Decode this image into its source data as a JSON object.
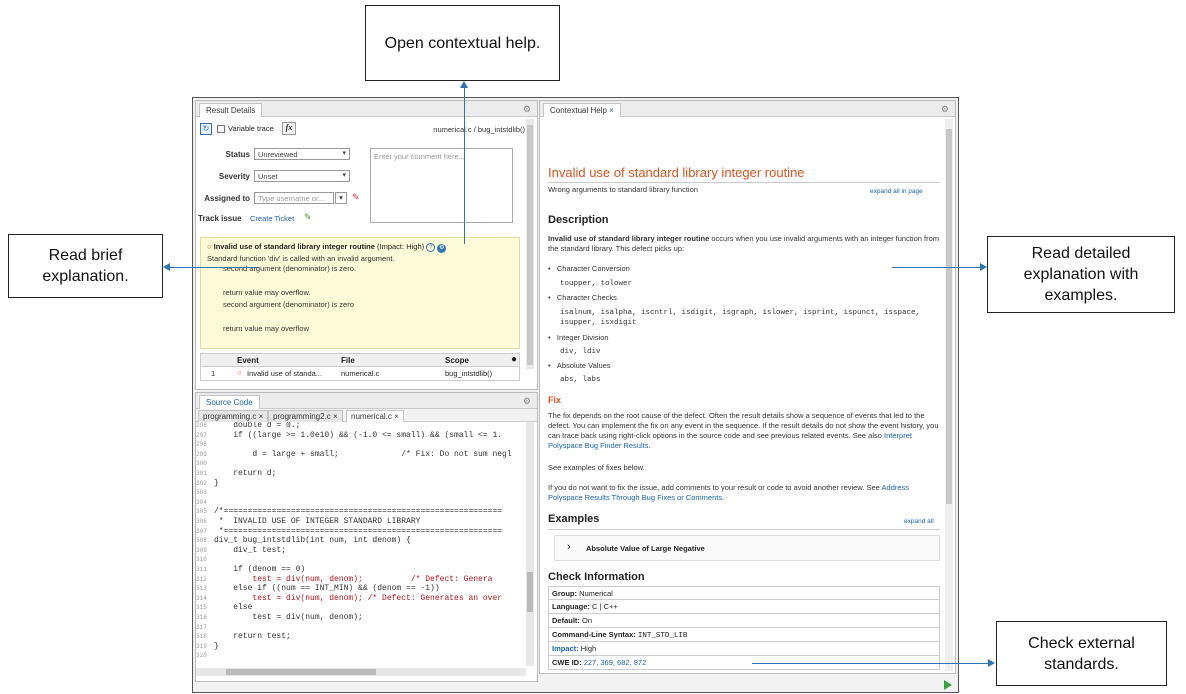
{
  "callouts": {
    "open_help": "Open contextual help.",
    "brief": "Read brief explanation.",
    "detailed": "Read detailed explanation with examples.",
    "standards": "Check external standards."
  },
  "result_details": {
    "tab": "Result Details",
    "variable_trace": "Variable trace",
    "fx": "fx",
    "file_func": "numerical.c / bug_intstdlib()",
    "status_label": "Status",
    "status_value": "Unreviewed",
    "severity_label": "Severity",
    "severity_value": "Unset",
    "assigned_label": "Assigned to",
    "assigned_placeholder": "Type username or...",
    "track_label": "Track issue",
    "create_ticket": "Create Ticket",
    "comment_placeholder": "Enter your comment here...",
    "defect_title": "Invalid use of standard library integer routine",
    "defect_impact": "(Impact: High)",
    "defect_lines": [
      "Standard function 'div' is called with an invalid argument.",
      "second argument (denominator) is zero.",
      "",
      "return value may overflow.",
      "second argument (denominator) is zero",
      "",
      "return value may overflow"
    ],
    "events_headers": [
      "Event",
      "File",
      "Scope"
    ],
    "events_row": {
      "num": "1",
      "event": "Invalid use of standa...",
      "file": "numerical.c",
      "scope": "bug_intstdlib()"
    }
  },
  "source": {
    "tab": "Source Code",
    "file_tabs": [
      "programming.c",
      "programming2.c",
      "numerical.c"
    ],
    "lines": [
      [
        "296",
        "    double d = 0.;"
      ],
      [
        "297",
        "    if ((large >= 1.0e10) && (-1.0 <= small) && (small <= 1."
      ],
      [
        "298",
        ""
      ],
      [
        "299",
        "        d = large + small;             /* Fix: Do not sum negl"
      ],
      [
        "300",
        ""
      ],
      [
        "301",
        "    return d;"
      ],
      [
        "302",
        "}"
      ],
      [
        "303",
        ""
      ],
      [
        "304",
        ""
      ],
      [
        "305",
        "/*=========================================================="
      ],
      [
        "306",
        " *  INVALID USE OF INTEGER STANDARD LIBRARY"
      ],
      [
        "307",
        " *=========================================================="
      ],
      [
        "308",
        "div_t bug_intstdlib(int num, int denom) {"
      ],
      [
        "309",
        "    div_t test;"
      ],
      [
        "310",
        ""
      ],
      [
        "311",
        "    if (denom == 0)"
      ],
      [
        "312",
        "        test = div(num, denom);          /* Defect: Genera"
      ],
      [
        "313",
        "    else if ((num == INT_MIN) && (denom == -1))"
      ],
      [
        "314",
        "        test = div(num, denom); /* Defect: Generates an over"
      ],
      [
        "315",
        "    else"
      ],
      [
        "316",
        "        test = div(num, denom);"
      ],
      [
        "317",
        ""
      ],
      [
        "318",
        "    return test;"
      ],
      [
        "319",
        "}"
      ],
      [
        "320",
        ""
      ]
    ]
  },
  "help": {
    "tab": "Contextual Help",
    "title": "Invalid use of standard library integer routine",
    "subtitle": "Wrong arguments to standard library function",
    "expand_all_page": "expand all in page",
    "description_h": "Description",
    "desc_bold": "Invalid use of standard library integer routine",
    "desc_rest": " occurs when you use invalid arguments with an integer function from the standard library. This defect picks up:",
    "items": [
      {
        "name": "Character Conversion",
        "code": "toupper, tolower"
      },
      {
        "name": "Character Checks",
        "code": "isalnum, isalpha, iscntrl, isdigit, isgraph, islower, isprint, ispunct, isspace, isupper, isxdigit"
      },
      {
        "name": "Integer Division",
        "code": "div, ldiv"
      },
      {
        "name": "Absolute Values",
        "code": "abs, labs"
      }
    ],
    "fix_h": "Fix",
    "fix_text": "The fix depends on the root cause of the defect. Often the result details show a sequence of events that led to the defect. You can implement the fix on any event in the sequence. If the result details do not show the event history, you can trace back using right-click options in the source code and see previous related events. See also ",
    "fix_link": "Interpret Polyspace Bug Finder Results",
    "see_examples": "See examples of fixes below.",
    "review_text": "If you do not want to fix the issue, add comments to your result or code to avoid another review. See ",
    "review_link": "Address Polyspace Results Through Bug Fixes or Comments",
    "examples_h": "Examples",
    "expand_all": "expand all",
    "example1": "Absolute Value of Large Negative",
    "check_h": "Check Information",
    "check_rows": [
      {
        "k": "Group:",
        "v": "Numerical"
      },
      {
        "k": "Language:",
        "v": "C | C++"
      },
      {
        "k": "Default:",
        "v": "On"
      },
      {
        "k": "Command-Line Syntax:",
        "v": "INT_STD_LIB"
      },
      {
        "k": "Impact:",
        "v": "High"
      },
      {
        "k": "CWE ID:",
        "v": "227, 369, 682, 872"
      }
    ]
  },
  "colors": {
    "accent": "#2e75b6",
    "title_orange": "#d9541e",
    "defect_bg": "#fdfbd8"
  }
}
